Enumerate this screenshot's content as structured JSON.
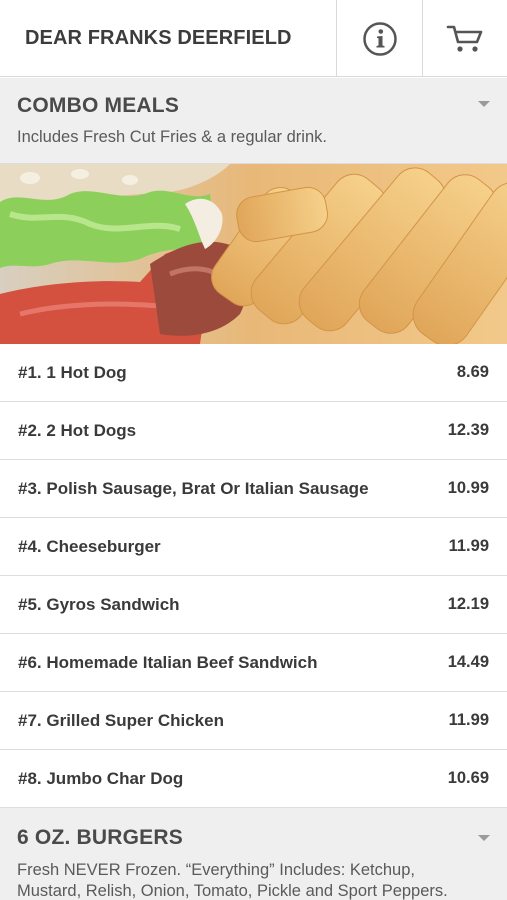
{
  "header": {
    "title": "DEAR FRANKS DEERFIELD",
    "info_icon": "info-circle-icon",
    "cart_icon": "shopping-cart-icon"
  },
  "sections": [
    {
      "title": "COMBO MEALS",
      "description": "Includes Fresh Cut Fries & a regular drink.",
      "image": "burger-and-fries-photo",
      "items": [
        {
          "name": "#1. 1 Hot Dog",
          "price": "8.69"
        },
        {
          "name": "#2. 2 Hot Dogs",
          "price": "12.39"
        },
        {
          "name": "#3. Polish Sausage, Brat Or Italian Sausage",
          "price": "10.99"
        },
        {
          "name": "#4. Cheeseburger",
          "price": "11.99"
        },
        {
          "name": "#5. Gyros Sandwich",
          "price": "12.19"
        },
        {
          "name": "#6. Homemade Italian Beef Sandwich",
          "price": "14.49"
        },
        {
          "name": "#7. Grilled Super Chicken",
          "price": "11.99"
        },
        {
          "name": "#8. Jumbo Char Dog",
          "price": "10.69"
        }
      ]
    },
    {
      "title": "6 OZ. BURGERS",
      "description_line1": "Fresh NEVER Frozen. “Everything” Includes: Ketchup,",
      "description_line2": "Mustard, Relish, Onion, Tomato, Pickle and Sport Peppers."
    }
  ],
  "colors": {
    "header_bg": "#ffffff",
    "category_bg": "#efefef",
    "text": "#3a3a3a",
    "divider": "#dedede"
  }
}
